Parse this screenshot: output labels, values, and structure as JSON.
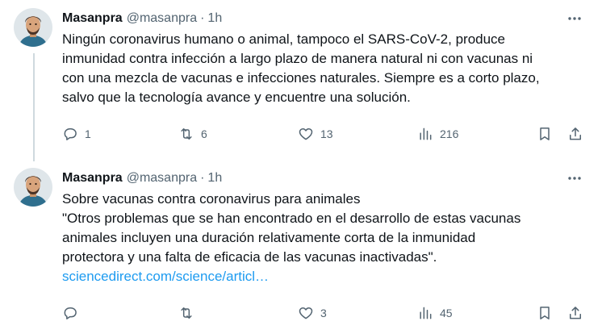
{
  "tweets": [
    {
      "author": {
        "name": "Masanpra",
        "handle": "@masanpra"
      },
      "separator": "·",
      "time": "1h",
      "text_lines": [
        "Ningún coronavirus humano o animal, tampoco el SARS-CoV-2, produce",
        "inmunidad contra infección a largo plazo de manera natural ni con vacunas ni",
        "con una mezcla de vacunas e infecciones naturales. Siempre es a corto plazo,",
        "salvo que la tecnología avance y encuentre una solución."
      ],
      "link": "",
      "stats": {
        "replies": "1",
        "retweets": "6",
        "likes": "13",
        "views": "216"
      }
    },
    {
      "author": {
        "name": "Masanpra",
        "handle": "@masanpra"
      },
      "separator": "·",
      "time": "1h",
      "text_lines": [
        "Sobre vacunas contra coronavirus para animales",
        "\"Otros problemas que se han encontrado en el desarrollo de estas vacunas",
        "animales incluyen una duración relativamente corta de la inmunidad",
        "protectora y una falta de eficacia de las vacunas inactivadas\"."
      ],
      "link": "sciencedirect.com/science/articl…",
      "stats": {
        "replies": "",
        "retweets": "",
        "likes": "3",
        "views": "45"
      }
    }
  ],
  "icons": {
    "more": "more-horizontal-icon",
    "reply": "reply-bubble-icon",
    "retweet": "retweet-icon",
    "like": "heart-icon",
    "views": "views-bar-icon",
    "bookmark": "bookmark-icon",
    "share": "share-icon"
  },
  "colors": {
    "text": "#0f1419",
    "secondary": "#536471",
    "link": "#1d9bf0",
    "thread_line": "#cfd9de"
  }
}
